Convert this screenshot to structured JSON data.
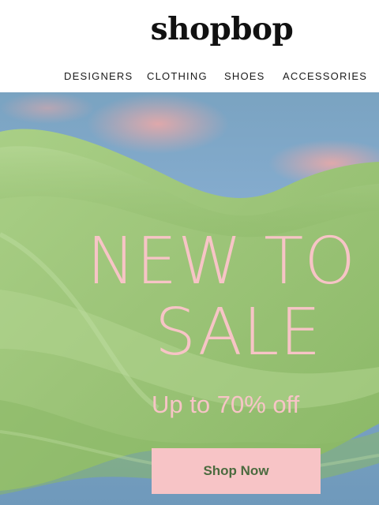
{
  "brand": {
    "logo_text": "shopbop"
  },
  "nav": {
    "items": [
      {
        "label": "DESIGNERS"
      },
      {
        "label": "CLOTHING"
      },
      {
        "label": "SHOES"
      },
      {
        "label": "ACCESSORIES"
      }
    ]
  },
  "hero": {
    "headline_line1": "NEW TO",
    "headline_line2": "SALE",
    "subhead": "Up to 70% off",
    "cta_label": "Shop Now",
    "colors": {
      "text": "#f7c4c6",
      "cta_background": "#f7c4c6",
      "cta_text": "#4b6b3f",
      "fabric": "#9cc478",
      "sky": "#80a9c9"
    }
  }
}
